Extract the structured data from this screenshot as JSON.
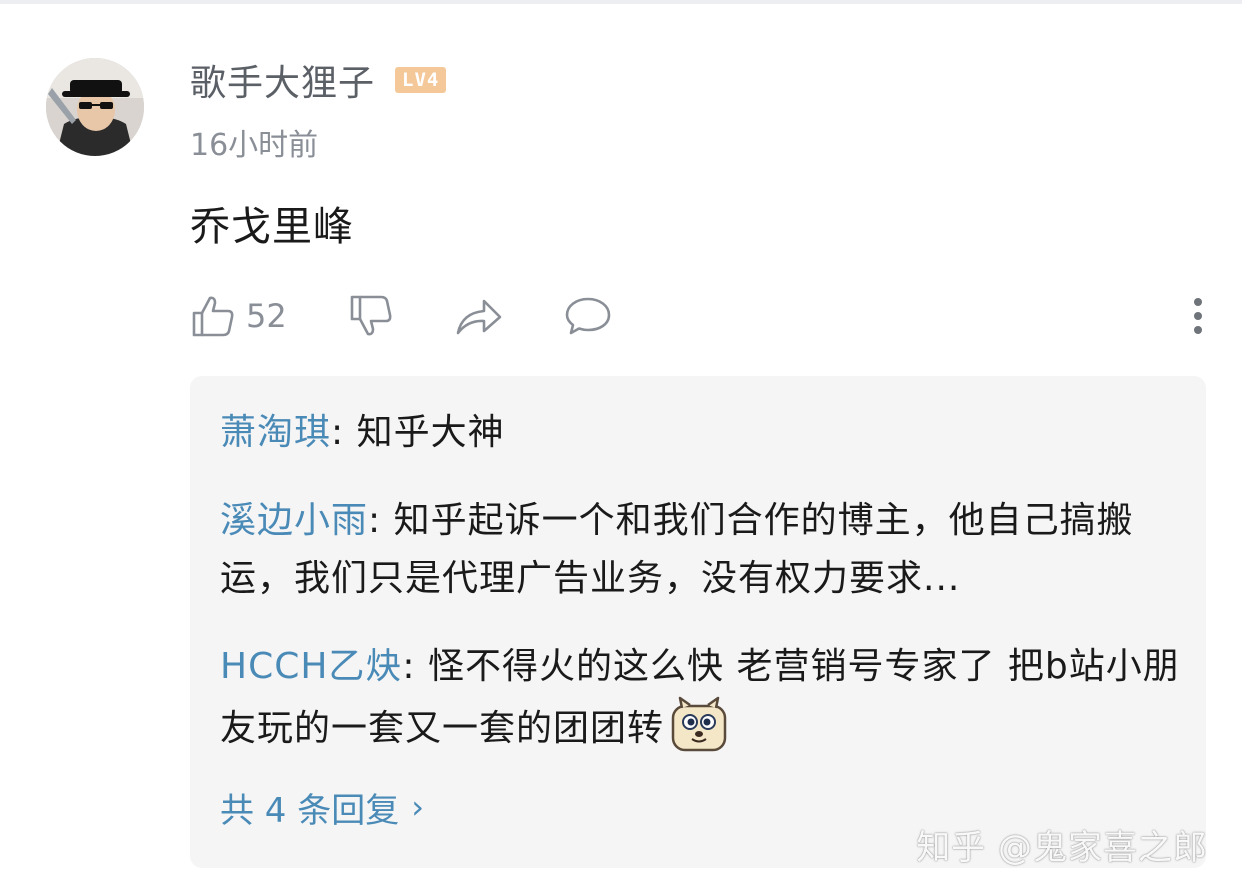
{
  "comment": {
    "author": "歌手大狸子",
    "level_badge": "LV4",
    "timestamp": "16小时前",
    "text": "乔戈里峰",
    "like_count": "52",
    "icons": [
      "thumbs-up-icon",
      "thumbs-down-icon",
      "share-icon",
      "comment-icon",
      "more-icon"
    ]
  },
  "replies": {
    "items": [
      {
        "name": "萧淘琪",
        "sep": ": ",
        "text": "知乎大神"
      },
      {
        "name": "溪边小雨",
        "sep": ": ",
        "text": "知乎起诉一个和我们合作的博主，他自己搞搬运，我们只是代理广告业务，没有权力要求..."
      },
      {
        "name": "HCCH乙炔",
        "sep": ": ",
        "text": "怪不得火的这么快 老营销号专家了 把b站小朋友玩的一套又一套的团团转"
      }
    ],
    "more_label": "共 4 条回复",
    "more_chevron": "›"
  },
  "watermark": "知乎 @鬼家喜之郎",
  "colors": {
    "link_blue": "#4a8ab7",
    "badge_orange": "#f5c89a",
    "reply_bg": "#f5f5f6"
  }
}
